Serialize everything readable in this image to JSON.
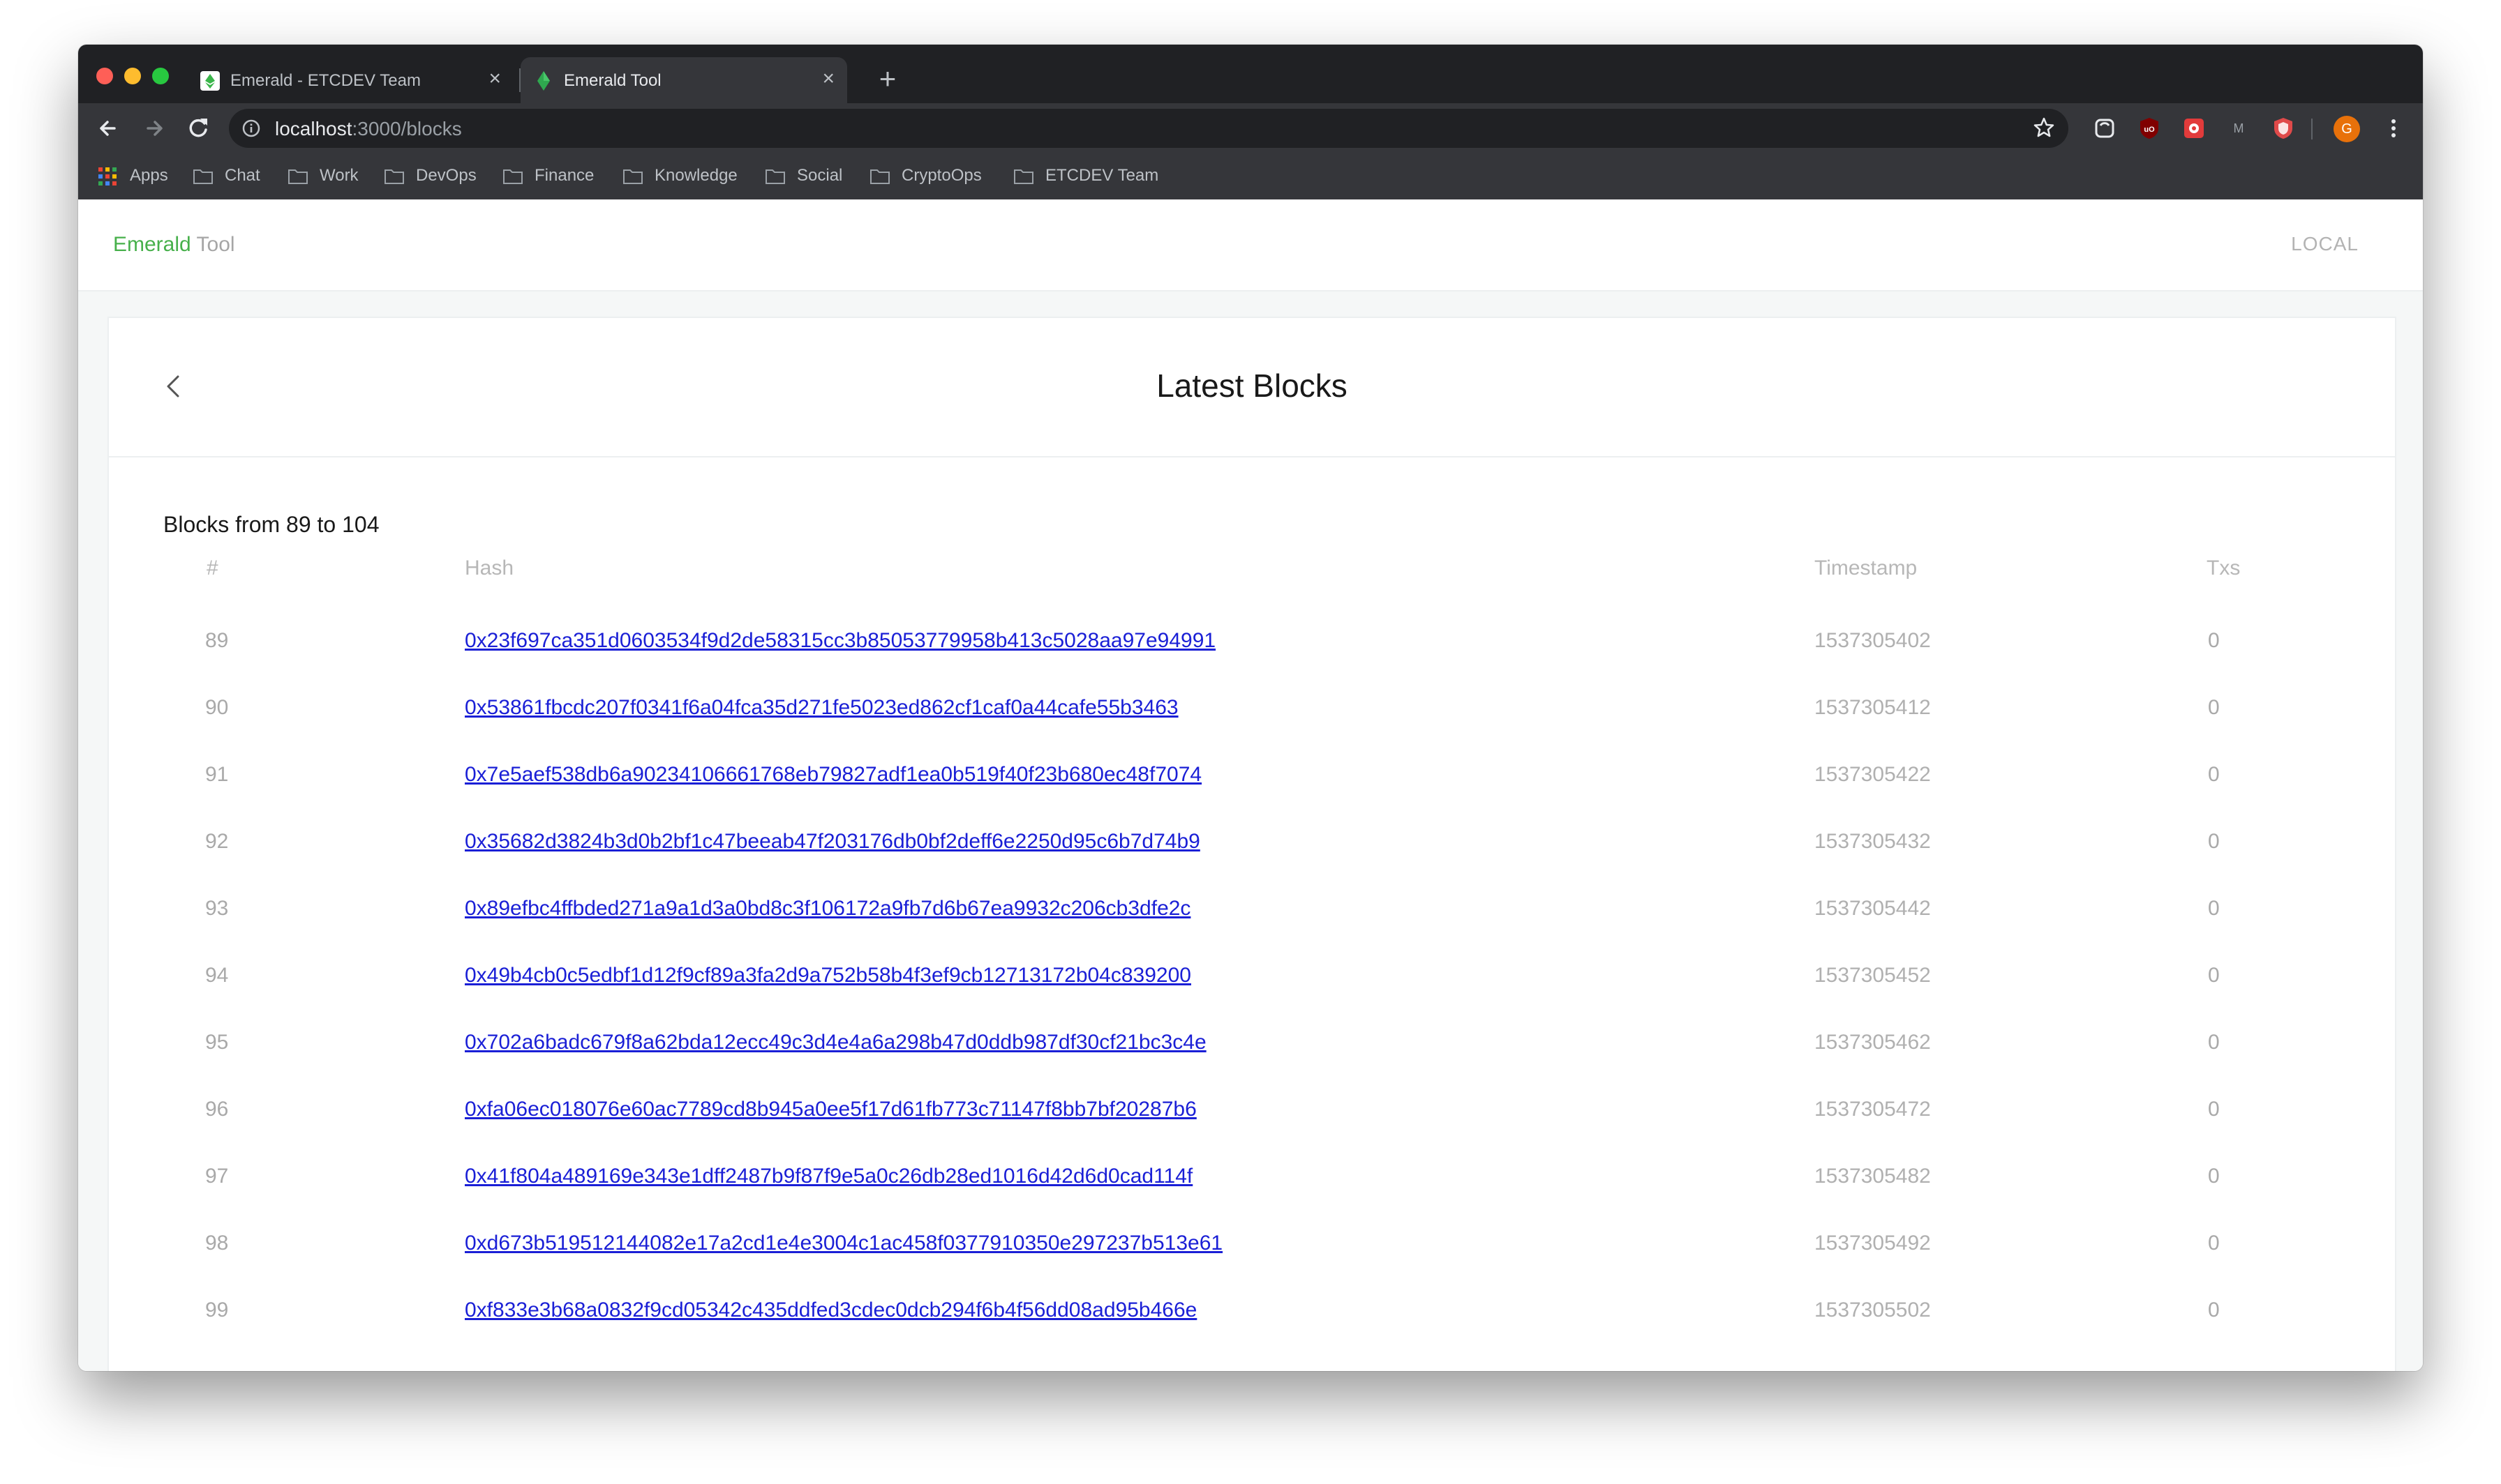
{
  "browser": {
    "tabs": [
      {
        "title": "Emerald - ETCDEV Team",
        "active": false
      },
      {
        "title": "Emerald Tool",
        "active": true
      }
    ],
    "url_host": "localhost",
    "url_path": ":3000/blocks",
    "bookmarks": [
      {
        "label": "Apps",
        "icon": "apps-grid-icon"
      },
      {
        "label": "Chat",
        "icon": "folder-icon"
      },
      {
        "label": "Work",
        "icon": "folder-icon"
      },
      {
        "label": "DevOps",
        "icon": "folder-icon"
      },
      {
        "label": "Finance",
        "icon": "folder-icon"
      },
      {
        "label": "Knowledge",
        "icon": "folder-icon"
      },
      {
        "label": "Social",
        "icon": "folder-icon"
      },
      {
        "label": "CryptoOps",
        "icon": "folder-icon"
      },
      {
        "label": "ETCDEV Team",
        "icon": "folder-icon"
      }
    ],
    "avatar_letter": "G",
    "ext_m_label": "M",
    "ext_ublock_label": "uO"
  },
  "app": {
    "brand_primary": "Emerald",
    "brand_secondary": "Tool",
    "network": "LOCAL",
    "page_title": "Latest Blocks",
    "range_text": "Blocks from 89 to 104",
    "columns": [
      "#",
      "Hash",
      "Timestamp",
      "Txs"
    ],
    "blocks": [
      {
        "number": "89",
        "hash": "0x23f697ca351d0603534f9d2de58315cc3b85053779958b413c5028aa97e94991",
        "timestamp": "1537305402",
        "txs": "0"
      },
      {
        "number": "90",
        "hash": "0x53861fbcdc207f0341f6a04fca35d271fe5023ed862cf1caf0a44cafe55b3463",
        "timestamp": "1537305412",
        "txs": "0"
      },
      {
        "number": "91",
        "hash": "0x7e5aef538db6a90234106661768eb79827adf1ea0b519f40f23b680ec48f7074",
        "timestamp": "1537305422",
        "txs": "0"
      },
      {
        "number": "92",
        "hash": "0x35682d3824b3d0b2bf1c47beeab47f203176db0bf2deff6e2250d95c6b7d74b9",
        "timestamp": "1537305432",
        "txs": "0"
      },
      {
        "number": "93",
        "hash": "0x89efbc4ffbded271a9a1d3a0bd8c3f106172a9fb7d6b67ea9932c206cb3dfe2c",
        "timestamp": "1537305442",
        "txs": "0"
      },
      {
        "number": "94",
        "hash": "0x49b4cb0c5edbf1d12f9cf89a3fa2d9a752b58b4f3ef9cb12713172b04c839200",
        "timestamp": "1537305452",
        "txs": "0"
      },
      {
        "number": "95",
        "hash": "0x702a6badc679f8a62bda12ecc49c3d4e4a6a298b47d0ddb987df30cf21bc3c4e",
        "timestamp": "1537305462",
        "txs": "0"
      },
      {
        "number": "96",
        "hash": "0xfa06ec018076e60ac7789cd8b945a0ee5f17d61fb773c71147f8bb7bf20287b6",
        "timestamp": "1537305472",
        "txs": "0"
      },
      {
        "number": "97",
        "hash": "0x41f804a489169e343e1dff2487b9f87f9e5a0c26db28ed1016d42d6d0cad114f",
        "timestamp": "1537305482",
        "txs": "0"
      },
      {
        "number": "98",
        "hash": "0xd673b519512144082e17a2cd1e4e3004c1ac458f0377910350e297237b513e61",
        "timestamp": "1537305492",
        "txs": "0"
      },
      {
        "number": "99",
        "hash": "0xf833e3b68a0832f9cd05342c435ddfed3cdec0dcb294f6b4f56dd08ad95b466e",
        "timestamp": "1537305502",
        "txs": "0"
      }
    ]
  },
  "colors": {
    "brand_green": "#47b04b",
    "link_blue": "#1a1fd6",
    "chrome_dark": "#202124",
    "chrome_toolbar": "#35363a"
  }
}
